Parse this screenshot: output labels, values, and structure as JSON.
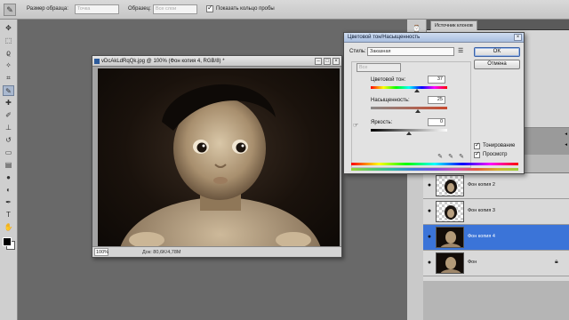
{
  "options_bar": {
    "size_label": "Размер образца:",
    "size_value": "Точка",
    "sample_label": "Образец:",
    "sample_value": "Все слои",
    "show_ring_label": "Показать кольцо пробы"
  },
  "document": {
    "title": "vDcAkLdRqQk.jpg @ 100% (Фон копия 4, RGB/8) *",
    "zoom": "100%",
    "doc_info": "Док: 80,6K/4,78M"
  },
  "dialog": {
    "title": "Цветовой тон/Насыщенность",
    "style_label": "Стиль:",
    "style_value": "Заказная",
    "channel_value": "Все",
    "hue_label": "Цветовой тон:",
    "hue_value": "37",
    "hue_fraction": 0.6,
    "saturation_label": "Насыщенность:",
    "saturation_value": "25",
    "saturation_fraction": 0.62,
    "lightness_label": "Яркость:",
    "lightness_value": "0",
    "lightness_fraction": 0.5,
    "ok_label": "OK",
    "cancel_label": "Отмена",
    "colorize_label": "Тонирование",
    "preview_label": "Просмотр"
  },
  "right_panel": {
    "tab_label": "Источник клонов"
  },
  "layers": [
    {
      "name": "Фон копия 2",
      "selected": false,
      "thumb": "checker-face"
    },
    {
      "name": "Фон копия 3",
      "selected": false,
      "thumb": "checker-face"
    },
    {
      "name": "Фон копия 4",
      "selected": true,
      "thumb": "photo"
    },
    {
      "name": "Фон",
      "selected": false,
      "thumb": "photo",
      "locked": true
    }
  ]
}
